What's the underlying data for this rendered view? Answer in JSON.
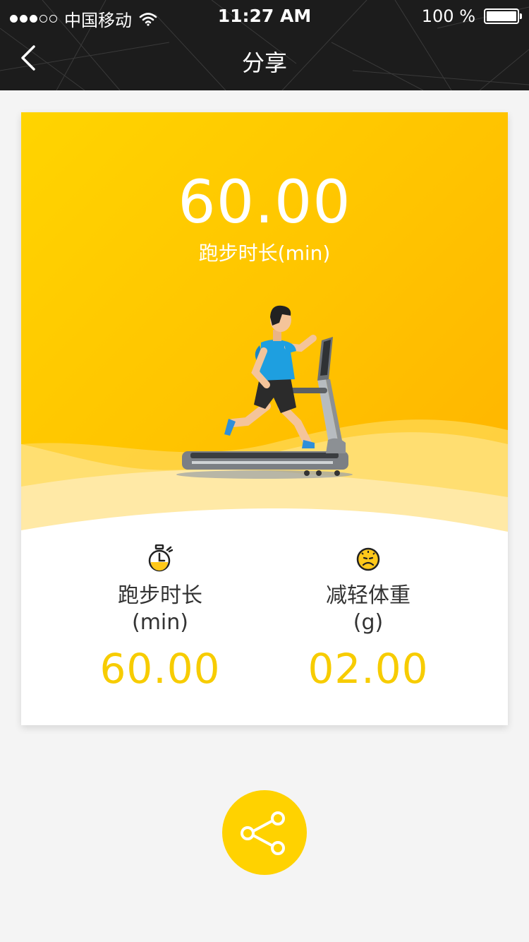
{
  "status_bar": {
    "carrier": "中国移动",
    "time": "11:27 AM",
    "battery": "100 %",
    "signal_bars_filled": 3,
    "signal_bars_total": 5
  },
  "nav": {
    "title": "分享",
    "back_icon": "chevron-left-icon"
  },
  "hero": {
    "value": "60.00",
    "label": "跑步时长(min)"
  },
  "stats": [
    {
      "icon": "stopwatch-icon",
      "label": "跑步时长",
      "unit": "(min)",
      "value": "60.00"
    },
    {
      "icon": "sad-scale-icon",
      "label": "减轻体重",
      "unit": "(g)",
      "value": "02.00"
    }
  ],
  "share": {
    "icon": "share-icon"
  },
  "colors": {
    "accent": "#ffd200",
    "value_text": "#f7cc00",
    "topbar": "#1c1c1c"
  }
}
